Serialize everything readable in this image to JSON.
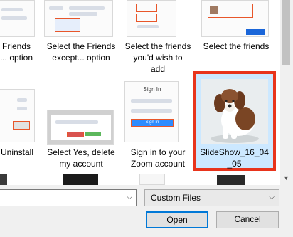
{
  "files": [
    {
      "name": "friends-option-caption",
      "caption": [
        "Friends",
        "... option"
      ]
    },
    {
      "name": "friends-except-caption",
      "caption": [
        "Select the Friends",
        "except... option"
      ]
    },
    {
      "name": "friends-wish-caption",
      "caption": [
        "Select the friends",
        "you'd wish to",
        "add"
      ]
    },
    {
      "name": "select-friends-caption",
      "caption": [
        "Select the friends"
      ]
    },
    {
      "name": "uninstall-caption",
      "caption": [
        "Uninstall"
      ]
    },
    {
      "name": "yes-delete-caption",
      "caption": [
        "Select Yes, delete",
        "my account"
      ]
    },
    {
      "name": "zoom-signin-caption",
      "caption": [
        "Sign in to your",
        "Zoom account"
      ]
    },
    {
      "name": "slideshow-caption",
      "caption": [
        "SlideShow_16_04",
        "_05"
      ]
    }
  ],
  "signin_thumb": {
    "title": "Sign In",
    "button": "Sign In"
  },
  "dialog": {
    "file_type_filter": "Custom Files",
    "open_label": "Open",
    "cancel_label": "Cancel"
  },
  "colors": {
    "selection_fill": "#cce8ff",
    "selection_outline": "#e8341c",
    "primary_button_border": "#0078d7"
  }
}
